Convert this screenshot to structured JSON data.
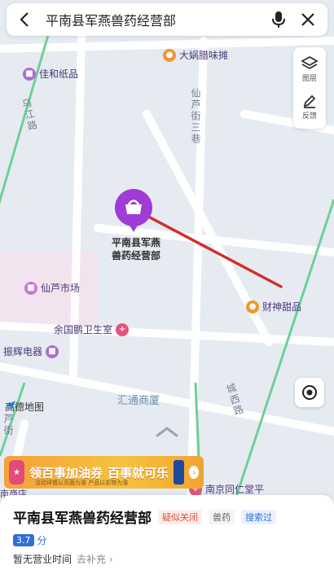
{
  "search": {
    "title": "平南县军燕兽药经营部"
  },
  "controls": {
    "layers_label": "图层",
    "feedback_label": "反馈"
  },
  "map": {
    "pois": {
      "jiahe": "佳和纸品",
      "dawok": "大娲腊味摊",
      "xianlu_market": "仙芦市场",
      "clinic": "余国鹏卫生室",
      "zhenhui": "振辉电器",
      "caishen": "财神甜品",
      "huitong": "汇通商厦",
      "nanjing": "南京同仁堂平",
      "south_store": "南商店"
    },
    "roads": {
      "wujiang": "乌江路",
      "xianlu_lane3": "仙芦街三巷",
      "chengxi": "城西路",
      "xianlu_street": "芦街"
    },
    "marker_label_line1": "平南县军燕",
    "marker_label_line2": "兽药经营部",
    "logo_text": "高德地图"
  },
  "banner": {
    "text_left": "领百事加油券",
    "text_right": "百事就可乐",
    "fine_print": "活动详情以页面为准 产品以实物为准"
  },
  "card": {
    "name": "平南县军燕兽药经营部",
    "tag_closed": "疑似关闭",
    "tag_category": "兽药",
    "tag_searched": "搜索过",
    "score": "3.7",
    "score_unit": "分",
    "hours": "暂无营业时间",
    "add_link": "去补充 ›"
  },
  "colors": {
    "accent": "#2f6fd8",
    "marker": "#a03bd6",
    "route": "#d0302b",
    "road_green": "#6fcf9a"
  }
}
